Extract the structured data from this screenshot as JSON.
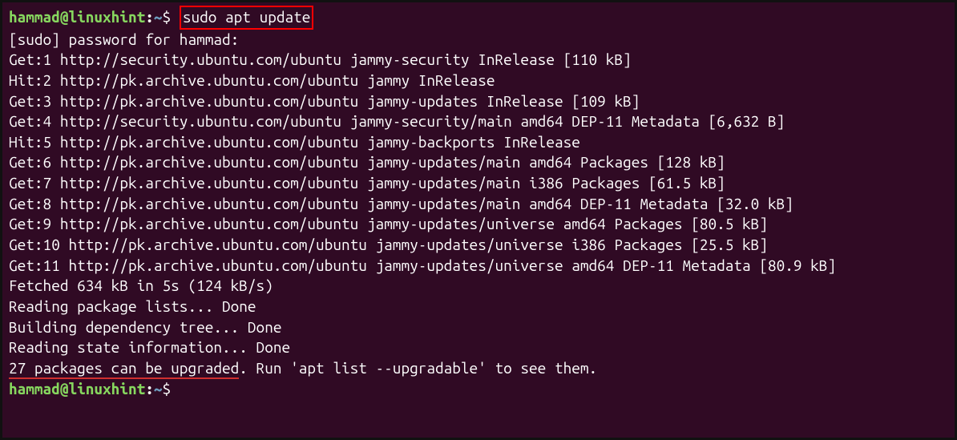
{
  "prompt": {
    "user": "hammad@linuxhint",
    "sep": ":",
    "path": "~",
    "symbol": "$"
  },
  "command": "sudo apt update",
  "lines": [
    "[sudo] password for hammad:",
    "Get:1 http://security.ubuntu.com/ubuntu jammy-security InRelease [110 kB]",
    "Hit:2 http://pk.archive.ubuntu.com/ubuntu jammy InRelease",
    "Get:3 http://pk.archive.ubuntu.com/ubuntu jammy-updates InRelease [109 kB]",
    "Get:4 http://security.ubuntu.com/ubuntu jammy-security/main amd64 DEP-11 Metadata [6,632 B]",
    "Hit:5 http://pk.archive.ubuntu.com/ubuntu jammy-backports InRelease",
    "Get:6 http://pk.archive.ubuntu.com/ubuntu jammy-updates/main amd64 Packages [128 kB]",
    "Get:7 http://pk.archive.ubuntu.com/ubuntu jammy-updates/main i386 Packages [61.5 kB]",
    "Get:8 http://pk.archive.ubuntu.com/ubuntu jammy-updates/main amd64 DEP-11 Metadata [32.0 kB]",
    "Get:9 http://pk.archive.ubuntu.com/ubuntu jammy-updates/universe amd64 Packages [80.5 kB]",
    "Get:10 http://pk.archive.ubuntu.com/ubuntu jammy-updates/universe i386 Packages [25.5 kB]",
    "Get:11 http://pk.archive.ubuntu.com/ubuntu jammy-updates/universe amd64 DEP-11 Metadata [80.9 kB]",
    "Fetched 634 kB in 5s (124 kB/s)",
    "Reading package lists... Done",
    "Building dependency tree... Done",
    "Reading state information... Done"
  ],
  "upgrade_line": {
    "highlight": "27 packages can be upgraded",
    "rest": ". Run 'apt list --upgradable' to see them."
  }
}
